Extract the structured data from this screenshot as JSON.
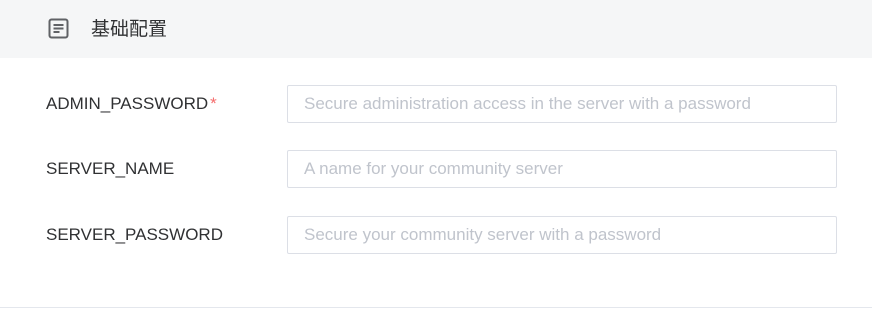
{
  "header": {
    "icon": "document-list-icon",
    "title": "基础配置"
  },
  "form": {
    "fields": [
      {
        "label": "ADMIN_PASSWORD",
        "required_mark": "*",
        "value": "",
        "placeholder": "Secure administration access in the server with a password"
      },
      {
        "label": "SERVER_NAME",
        "value": "",
        "placeholder": "A name for your community server"
      },
      {
        "label": "SERVER_PASSWORD",
        "value": "",
        "placeholder": "Secure your community server with a password"
      }
    ]
  },
  "colors": {
    "header_background": "#f5f6f7",
    "required_mark": "#f56c6c",
    "input_border": "#dcdfe6",
    "placeholder": "#c0c4cc",
    "text": "#303133"
  }
}
